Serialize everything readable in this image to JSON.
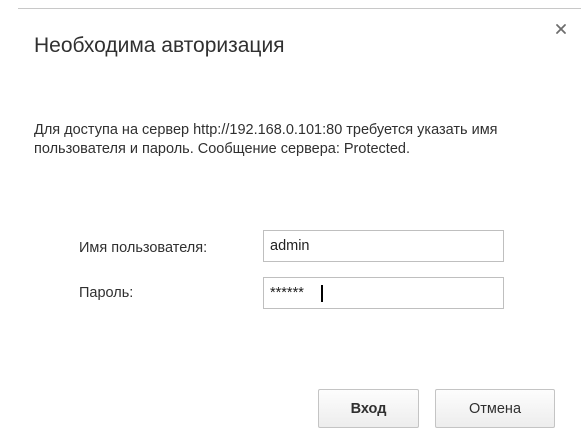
{
  "dialog": {
    "title": "Необходима авторизация",
    "message": "Для доступа на сервер http://192.168.0.101:80 требуется указать имя пользователя и пароль. Сообщение сервера: Protected.",
    "close_icon": "close-icon"
  },
  "form": {
    "username_label": "Имя пользователя:",
    "username_value": "admin",
    "password_label": "Пароль:",
    "password_value": "******"
  },
  "buttons": {
    "login_label": "Вход",
    "cancel_label": "Отмена"
  }
}
